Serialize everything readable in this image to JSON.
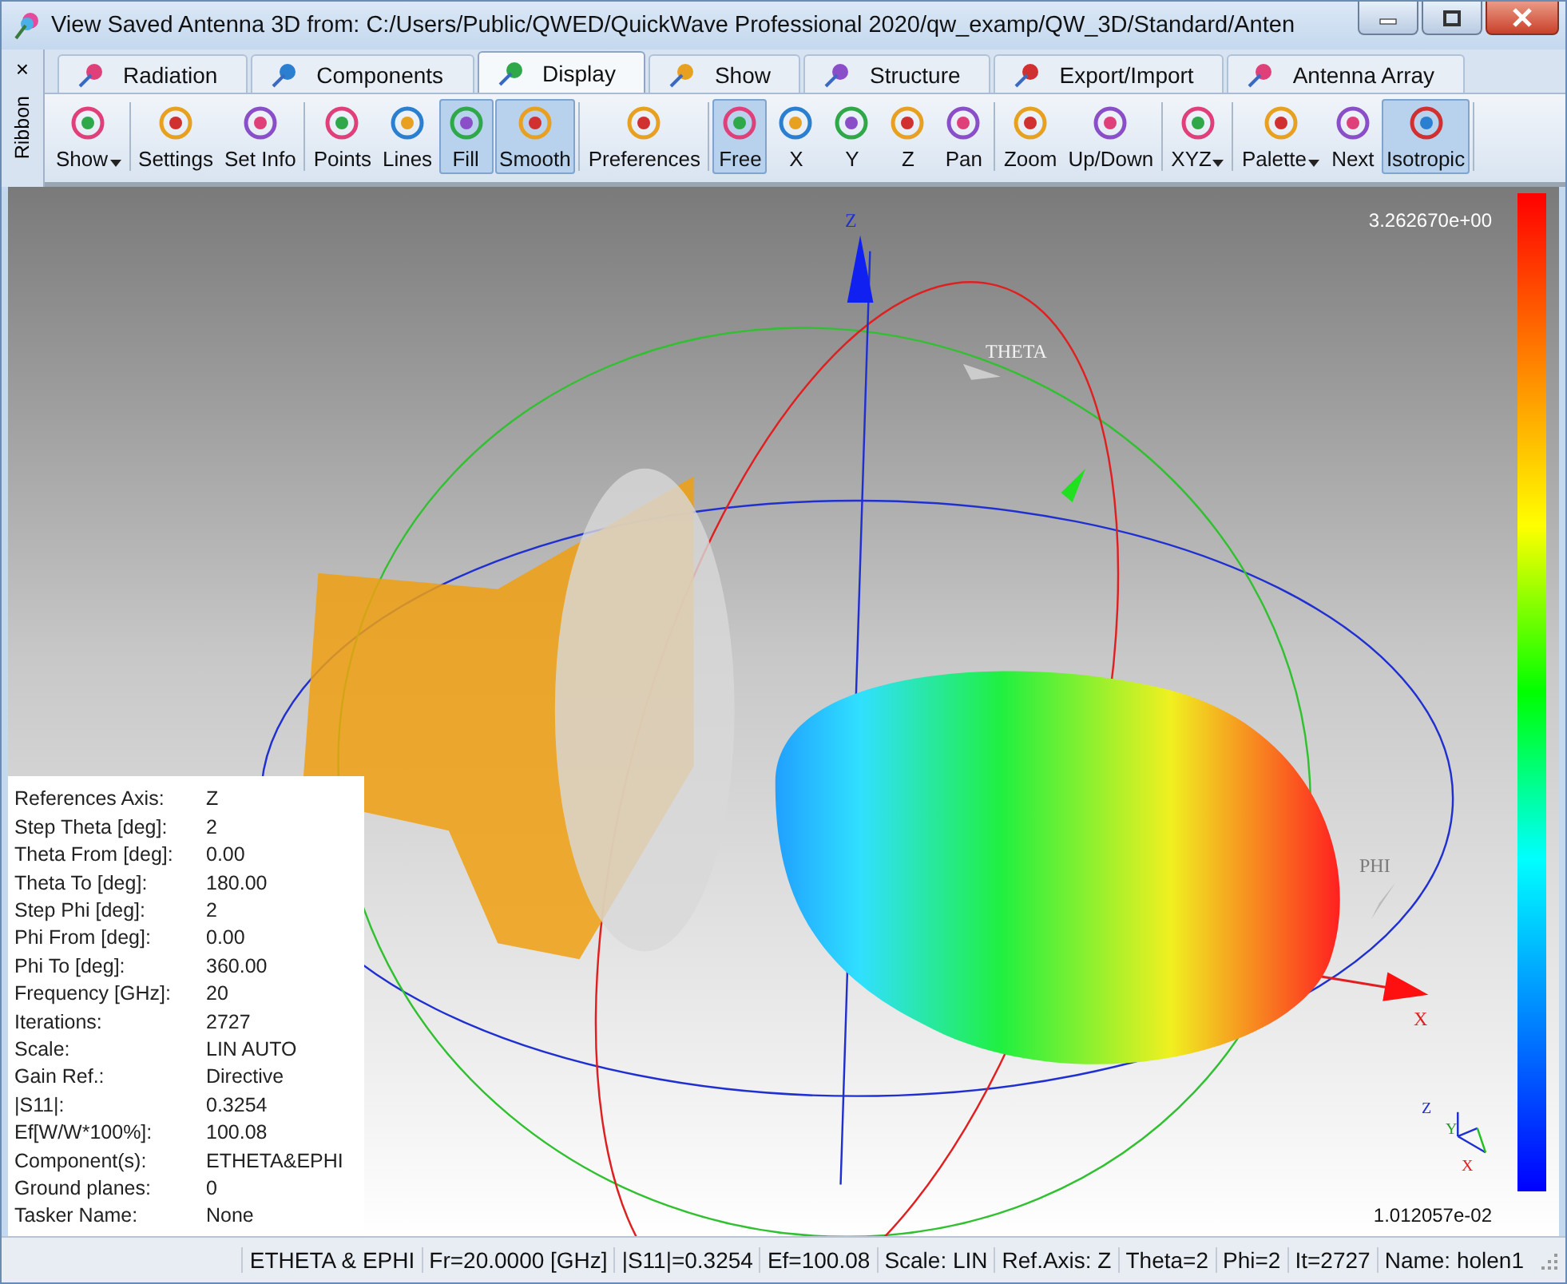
{
  "window": {
    "title": "View Saved Antenna 3D from: C:/Users/Public/QWED/QuickWave Professional 2020/qw_examp/QW_3D/Standard/Anten"
  },
  "ribbon": {
    "close": "×",
    "label": "Ribbon"
  },
  "tabs": [
    {
      "label": "Radiation",
      "selected": false
    },
    {
      "label": "Components",
      "selected": false
    },
    {
      "label": "Display",
      "selected": true
    },
    {
      "label": "Show",
      "selected": false
    },
    {
      "label": "Structure",
      "selected": false
    },
    {
      "label": "Export/Import",
      "selected": false
    },
    {
      "label": "Antenna Array",
      "selected": false
    }
  ],
  "toolbar_groups": [
    [
      {
        "label": "Show",
        "selected": false,
        "dropdown": true
      }
    ],
    [
      {
        "label": "Settings",
        "selected": false,
        "dropdown": false
      },
      {
        "label": "Set Info",
        "selected": false,
        "dropdown": false
      }
    ],
    [
      {
        "label": "Points",
        "selected": false,
        "dropdown": false
      },
      {
        "label": "Lines",
        "selected": false,
        "dropdown": false
      },
      {
        "label": "Fill",
        "selected": true,
        "dropdown": false
      },
      {
        "label": "Smooth",
        "selected": true,
        "dropdown": false
      }
    ],
    [
      {
        "label": "Preferences",
        "selected": false,
        "dropdown": false
      }
    ],
    [
      {
        "label": "Free",
        "selected": true,
        "dropdown": false
      },
      {
        "label": "X",
        "selected": false,
        "dropdown": false
      },
      {
        "label": "Y",
        "selected": false,
        "dropdown": false
      },
      {
        "label": "Z",
        "selected": false,
        "dropdown": false
      },
      {
        "label": "Pan",
        "selected": false,
        "dropdown": false
      }
    ],
    [
      {
        "label": "Zoom",
        "selected": false,
        "dropdown": false
      },
      {
        "label": "Up/Down",
        "selected": false,
        "dropdown": false
      }
    ],
    [
      {
        "label": "XYZ",
        "selected": false,
        "dropdown": true
      }
    ],
    [
      {
        "label": "Palette",
        "selected": false,
        "dropdown": true
      },
      {
        "label": "Next",
        "selected": false,
        "dropdown": false
      },
      {
        "label": "Isotropic",
        "selected": true,
        "dropdown": false
      }
    ]
  ],
  "viewport": {
    "scale_max": "3.262670e+00",
    "scale_min": "1.012057e-02",
    "axis_labels": [
      "Z",
      "THETA",
      "PHI",
      "X"
    ],
    "triad_labels": [
      "Z",
      "Y",
      "X"
    ]
  },
  "info_panel": [
    {
      "label": "References Axis:",
      "value": "Z"
    },
    {
      "label": "Step Theta [deg]:",
      "value": "2"
    },
    {
      "label": "Theta From [deg]:",
      "value": "0.00"
    },
    {
      "label": "Theta To [deg]:",
      "value": "180.00"
    },
    {
      "label": "Step Phi [deg]:",
      "value": "2"
    },
    {
      "label": "Phi From [deg]:",
      "value": "0.00"
    },
    {
      "label": "Phi To [deg]:",
      "value": "360.00"
    },
    {
      "label": "Frequency [GHz]:",
      "value": "20"
    },
    {
      "label": "Iterations:",
      "value": "2727"
    },
    {
      "label": "Scale:",
      "value": "LIN AUTO"
    },
    {
      "label": "Gain Ref.:",
      "value": "Directive"
    },
    {
      "label": "|S11|:",
      "value": "0.3254"
    },
    {
      "label": "Ef[W/W*100%]:",
      "value": "100.08"
    },
    {
      "label": "Component(s):",
      "value": "ETHETA&EPHI"
    },
    {
      "label": "Ground planes:",
      "value": "0"
    },
    {
      "label": "Tasker Name:",
      "value": "None"
    }
  ],
  "status_bar": [
    "ETHETA & EPHI",
    "Fr=20.0000 [GHz]",
    "|S11|=0.3254",
    "Ef=100.08",
    "Scale: LIN",
    "Ref.Axis: Z",
    "Theta=2",
    "Phi=2",
    "It=2727",
    "Name: holen1"
  ]
}
